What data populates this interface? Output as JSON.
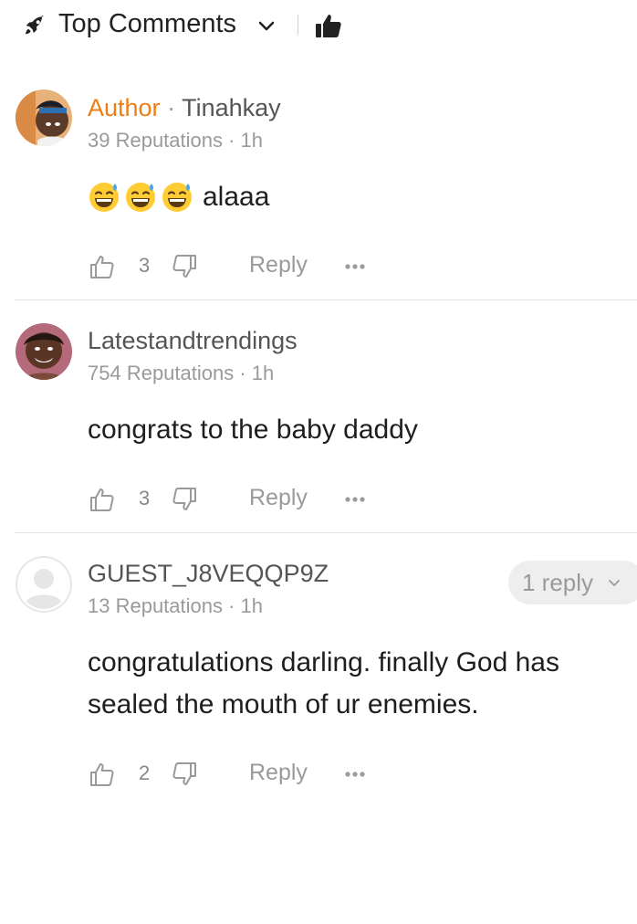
{
  "header": {
    "sort_label": "Top Comments",
    "icons": [
      "rocket-icon",
      "chevron-down-icon",
      "thumbs-up-icon"
    ]
  },
  "comments": [
    {
      "author_tag": "Author",
      "author_sep": " · ",
      "username": "Tinahkay",
      "reputation": "39 Reputations · 1h",
      "emojis": [
        "grinning-sweat-emoji",
        "grinning-sweat-emoji",
        "grinning-sweat-emoji"
      ],
      "text": "alaaa",
      "likes": "3",
      "reply_label": "Reply"
    },
    {
      "username": "Latestandtrendings",
      "reputation": "754 Reputations · 1h",
      "text": "congrats to the baby daddy",
      "likes": "3",
      "reply_label": "Reply"
    },
    {
      "username": "GUEST_J8VEQQP9Z",
      "reputation": "13 Reputations · 1h",
      "text": "congratulations darling. finally God has sealed the mouth of ur enemies.",
      "likes": "2",
      "reply_label": "Reply",
      "replies_button": "1 reply"
    }
  ],
  "colors": {
    "author_accent": "#f07d14",
    "muted_text": "#9a9a9a",
    "divider": "#e3e3e3"
  }
}
